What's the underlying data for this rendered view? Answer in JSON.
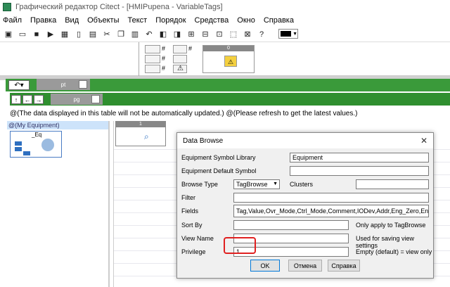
{
  "app": {
    "title": "Графический редактор Citect - [HMIPupena - VariableTags]"
  },
  "menu": [
    "Файл",
    "Правка",
    "Вид",
    "Объекты",
    "Текст",
    "Порядок",
    "Средства",
    "Окно",
    "Справка"
  ],
  "toolbar": {
    "help_glyph": "?"
  },
  "library": {
    "symbol_header": "0",
    "labels": [
      "#",
      "#",
      "#",
      "#"
    ]
  },
  "tabs": {
    "page1": "pt",
    "page2": "pg"
  },
  "nav": {
    "up": "↑",
    "back": "←",
    "forward": "→"
  },
  "notice": "@(The data displayed in this table will not be automatically updated.) @(Please refresh to get the latest values.)",
  "tree": {
    "selected": "@(My Equipment)",
    "equipment_label": "_Eq"
  },
  "grid": {
    "thumb_header": "1"
  },
  "dialog": {
    "title": "Data Browse",
    "close": "✕",
    "fields": {
      "equipment_symbol_library_label": "Equipment Symbol Library",
      "equipment_symbol_library_value": "Equipment",
      "equipment_default_symbol_label": "Equipment Default Symbol",
      "equipment_default_symbol_value": "",
      "browse_type_label": "Browse Type",
      "browse_type_value": "TagBrowse",
      "clusters_label": "Clusters",
      "clusters_value": "",
      "filter_label": "Filter",
      "filter_value": "",
      "fields_label": "Fields",
      "fields_value": "Tag,Value,Ovr_Mode,Ctrl_Mode,Comment,IODev,Addr,Eng_Zero,Eng_Full,E",
      "sort_by_label": "Sort By",
      "sort_by_value": "",
      "sort_by_note": "Only apply to TagBrowse",
      "view_name_label": "View Name",
      "view_name_value": "",
      "view_name_note": "Used for saving view settings",
      "privilege_label": "Privilege",
      "privilege_value": "1",
      "privilege_note": "Empty (default) = view only"
    },
    "buttons": {
      "ok": "OK",
      "cancel": "Отмена",
      "help": "Справка"
    }
  },
  "colors": {
    "green": "#3a9a3a",
    "highlight": "#e02020",
    "accent": "#0078d7"
  }
}
